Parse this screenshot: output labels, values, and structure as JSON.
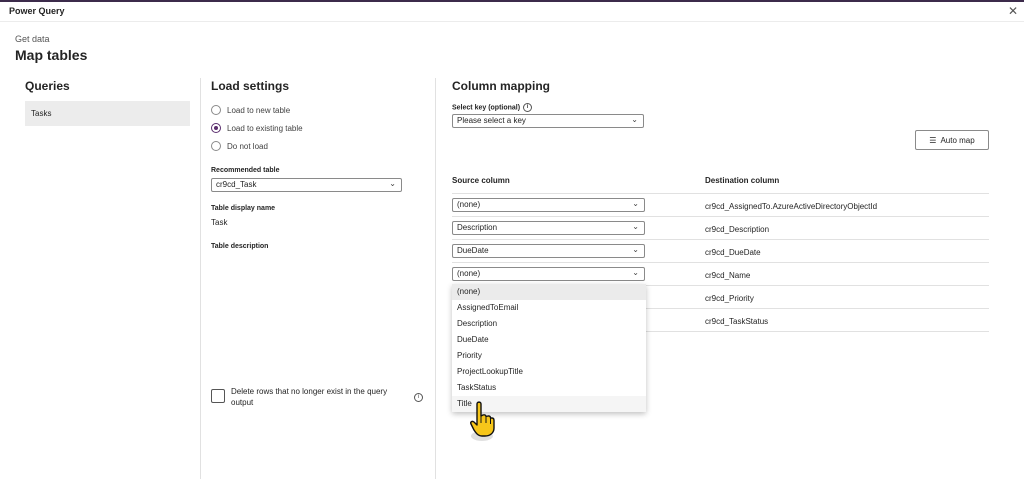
{
  "window": {
    "title": "Power Query"
  },
  "header": {
    "breadcrumb": "Get data",
    "title": "Map tables"
  },
  "queries": {
    "heading": "Queries",
    "items": [
      "Tasks"
    ]
  },
  "load_settings": {
    "heading": "Load settings",
    "options": [
      "Load to new table",
      "Load to existing table",
      "Do not load"
    ],
    "selected": "Load to existing table",
    "recommended_label": "Recommended table",
    "recommended_value": "cr9cd_Task",
    "display_name_label": "Table display name",
    "display_name_value": "Task",
    "description_label": "Table description",
    "delete_rows_label": "Delete rows that no longer exist in the query output"
  },
  "mapping": {
    "heading": "Column mapping",
    "key_label": "Select key (optional)",
    "key_placeholder": "Please select a key",
    "automap_label": "Auto map",
    "col_source": "Source column",
    "col_dest": "Destination column",
    "rows": [
      {
        "source": "(none)",
        "dest": "cr9cd_AssignedTo.AzureActiveDirectoryObjectId"
      },
      {
        "source": "Description",
        "dest": "cr9cd_Description"
      },
      {
        "source": "DueDate",
        "dest": "cr9cd_DueDate"
      },
      {
        "source": "(none)",
        "dest": "cr9cd_Name"
      },
      {
        "source": "",
        "dest": "cr9cd_Priority"
      },
      {
        "source": "",
        "dest": "cr9cd_TaskStatus"
      }
    ],
    "dropdown_options": [
      "(none)",
      "AssignedToEmail",
      "Description",
      "DueDate",
      "Priority",
      "ProjectLookupTitle",
      "TaskStatus",
      "Title"
    ]
  },
  "icons": {
    "close": "close-icon",
    "info": "info-icon",
    "automap": "list-icon",
    "chevron": "chevron-down-icon",
    "cursor": "hand-pointer-icon"
  },
  "colors": {
    "accent": "#5b2e6e",
    "topbar": "#3c2b4b"
  }
}
